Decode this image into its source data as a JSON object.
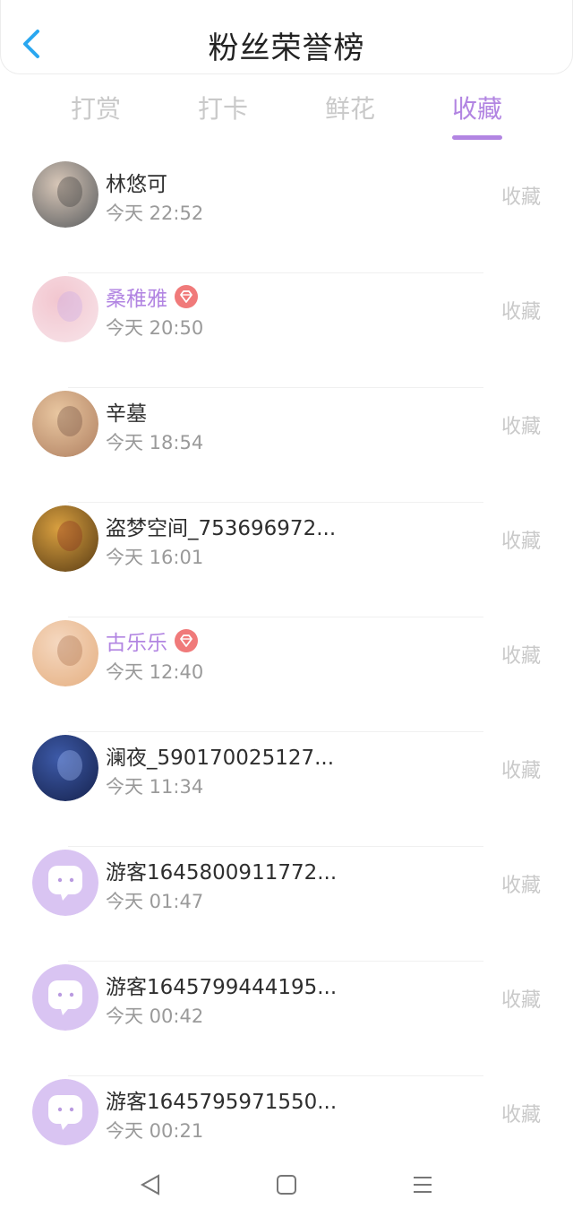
{
  "header": {
    "title": "粉丝荣誉榜",
    "back_icon": "chevron-left-icon",
    "accent_color": "#2aa7f0"
  },
  "tabs": [
    {
      "label": "打赏",
      "active": false
    },
    {
      "label": "打卡",
      "active": false
    },
    {
      "label": "鲜花",
      "active": false
    },
    {
      "label": "收藏",
      "active": true
    }
  ],
  "theme": {
    "active_color": "#b285e2",
    "inactive_color": "#c9c9c9"
  },
  "fans": [
    {
      "name": "林悠可",
      "time": "今天 22:52",
      "action": "收藏",
      "vip": false,
      "avatar": "photo-avatar"
    },
    {
      "name": "桑稚雅",
      "time": "今天 20:50",
      "action": "收藏",
      "vip": true,
      "avatar": "photo-avatar"
    },
    {
      "name": "辛墓",
      "time": "今天 18:54",
      "action": "收藏",
      "vip": false,
      "avatar": "photo-avatar"
    },
    {
      "name": "盗梦空间_753696972...",
      "time": "今天 16:01",
      "action": "收藏",
      "vip": false,
      "avatar": "photo-avatar"
    },
    {
      "name": "古乐乐",
      "time": "今天 12:40",
      "action": "收藏",
      "vip": true,
      "avatar": "photo-avatar"
    },
    {
      "name": "澜夜_590170025127...",
      "time": "今天 11:34",
      "action": "收藏",
      "vip": false,
      "avatar": "photo-avatar"
    },
    {
      "name": "游客1645800911772...",
      "time": "今天 01:47",
      "action": "收藏",
      "vip": false,
      "avatar": "default-chat-avatar"
    },
    {
      "name": "游客1645799444195...",
      "time": "今天 00:42",
      "action": "收藏",
      "vip": false,
      "avatar": "default-chat-avatar"
    },
    {
      "name": "游客1645795971550...",
      "time": "今天 00:21",
      "action": "收藏",
      "vip": false,
      "avatar": "default-chat-avatar"
    }
  ],
  "navbar": {
    "back_icon": "triangle-back-icon",
    "home_icon": "square-home-icon",
    "menu_icon": "menu-lines-icon"
  }
}
